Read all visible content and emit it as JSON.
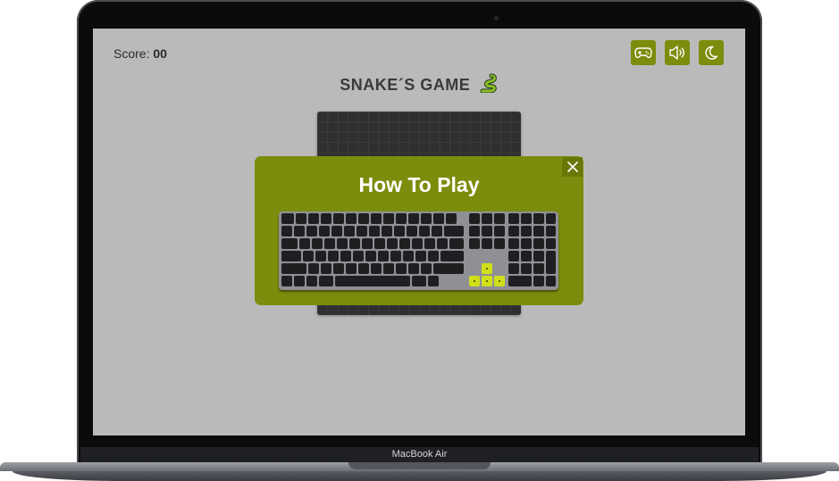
{
  "device": {
    "label": "MacBook Air"
  },
  "game": {
    "score_label": "Score:",
    "score_value": "00",
    "title": "SNAKE´S GAME",
    "title_icon": "snake-icon"
  },
  "toolbar": {
    "buttons": [
      {
        "name": "controls",
        "icon": "gamepad-icon"
      },
      {
        "name": "sound",
        "icon": "speaker-icon"
      },
      {
        "name": "theme",
        "icon": "moon-icon"
      }
    ]
  },
  "modal": {
    "title": "How To Play",
    "close_icon": "close-icon",
    "image": "keyboard-arrow-keys-highlighted"
  },
  "colors": {
    "accent": "#7c8c0c",
    "screen_bg": "#bababa",
    "board": "#2f2f2f",
    "arrow_highlight": "#cfe01a"
  }
}
